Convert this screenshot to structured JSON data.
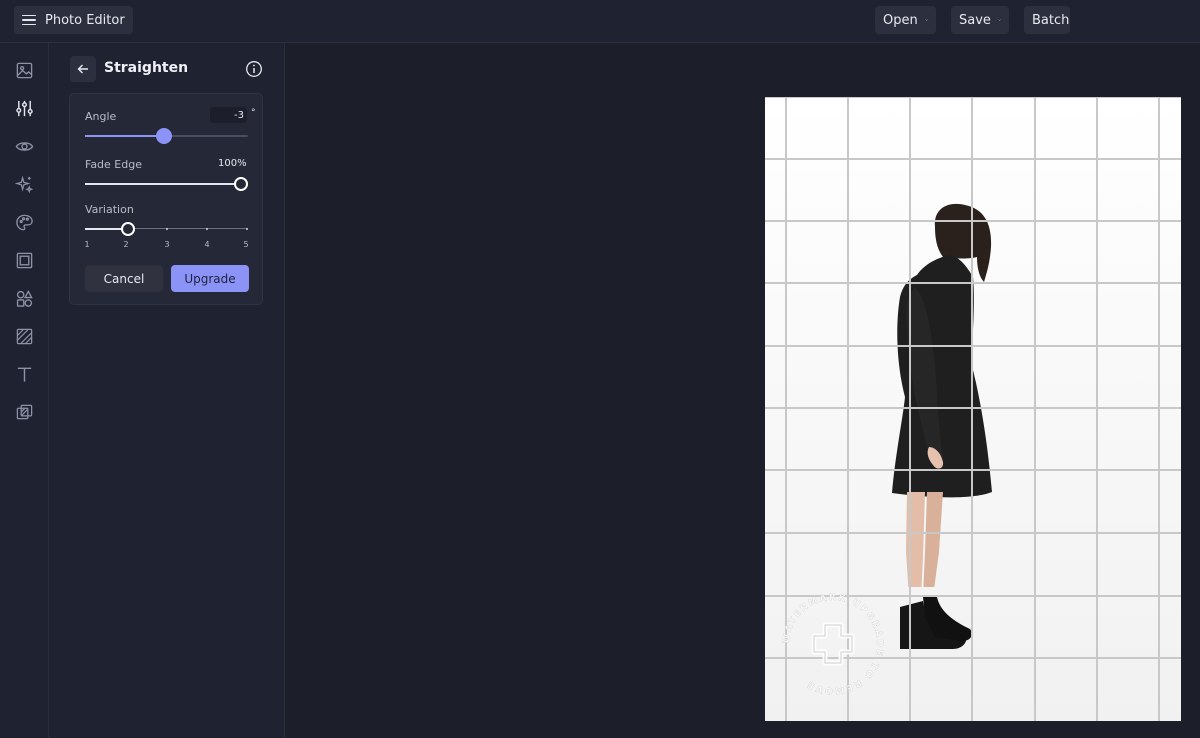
{
  "header": {
    "app_title": "Photo Editor",
    "menu_icon": "hamburger-menu-icon",
    "buttons": [
      {
        "label": "Open",
        "icon": "chevron-down-icon"
      },
      {
        "label": "Save",
        "icon": "chevron-down-icon"
      },
      {
        "label": "Batch"
      }
    ]
  },
  "sidebar": {
    "tools": [
      {
        "icon": "image-icon"
      },
      {
        "icon": "sliders-icon",
        "active": true
      },
      {
        "icon": "eye-icon"
      },
      {
        "icon": "sparkles-icon"
      },
      {
        "icon": "palette-icon"
      },
      {
        "icon": "frame-icon"
      },
      {
        "icon": "shapes-icon"
      },
      {
        "icon": "texture-icon"
      },
      {
        "icon": "text-icon"
      },
      {
        "icon": "overlay-icon"
      }
    ]
  },
  "panel": {
    "title": "Straighten",
    "back_icon": "arrow-left-icon",
    "info_icon": "info-icon",
    "angle": {
      "label": "Angle",
      "value": "-3",
      "unit": "°",
      "slider_fraction": 0.48
    },
    "fade_edge": {
      "label": "Fade Edge",
      "value": "100%",
      "slider_fraction": 1.0
    },
    "variation": {
      "label": "Variation",
      "ticks": [
        "1",
        "2",
        "3",
        "4",
        "5"
      ],
      "selected": 2
    },
    "cancel_label": "Cancel",
    "upgrade_label": "Upgrade"
  },
  "canvas": {
    "watermark": "WATERMARK UPGRADE TO REMOVE",
    "grid_columns": 6,
    "grid_rows": 10
  },
  "colors": {
    "accent": "#8b93f6",
    "background": "#1c1e29",
    "panel": "#1f2230"
  }
}
